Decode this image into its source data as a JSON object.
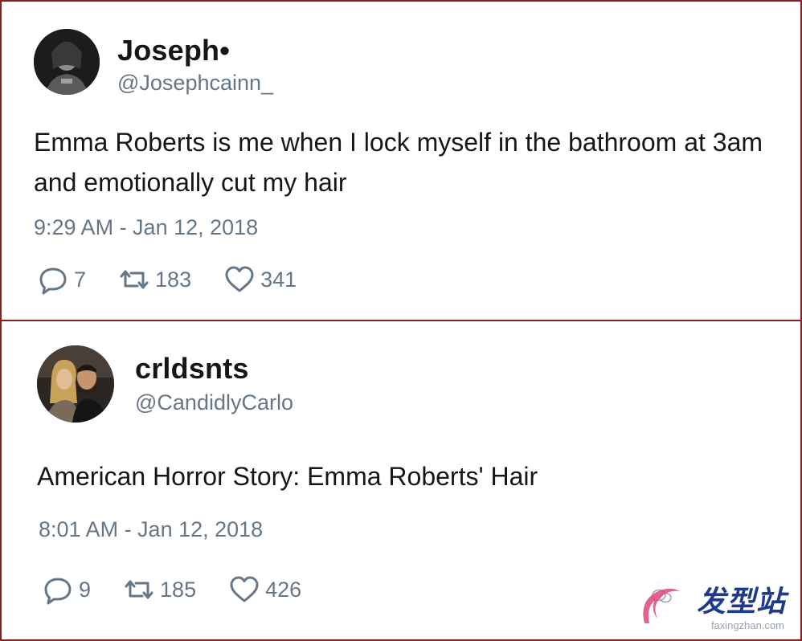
{
  "tweets": [
    {
      "name": "Joseph•",
      "handle": "@Josephcainn_",
      "text": "Emma Roberts is me when I lock myself in the bathroom at 3am and emotionally cut my hair",
      "timestamp": "9:29 AM - Jan 12, 2018",
      "replies": "7",
      "retweets": "183",
      "likes": "341"
    },
    {
      "name": "crldsnts",
      "handle": "@CandidlyCarlo",
      "text": "American Horror Story: Emma Roberts' Hair",
      "timestamp": "8:01 AM - Jan 12, 2018",
      "replies": "9",
      "retweets": "185",
      "likes": "426"
    }
  ],
  "watermark": {
    "brand": "发型站",
    "url": "faxingzhan.com"
  },
  "icons": {
    "reply": "reply-icon",
    "retweet": "retweet-icon",
    "like": "heart-icon"
  },
  "colors": {
    "border": "#8a1f1f",
    "name": "#14171a",
    "muted": "#657786",
    "watermark_brand": "#1e3a8a",
    "watermark_swoosh": "#e0457b"
  }
}
